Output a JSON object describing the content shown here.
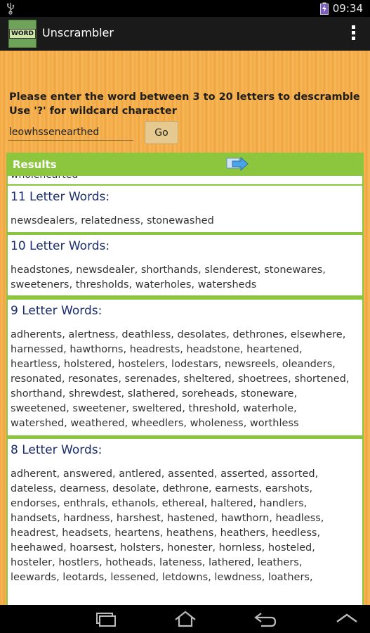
{
  "status_bar": {
    "time": "09:34"
  },
  "action_bar": {
    "icon_text": "WORD",
    "title": "Unscrambler"
  },
  "prompt": {
    "line1": "Please enter the word between 3 to 20 letters to descramble",
    "line2": "Use '?' for wildcard character"
  },
  "input": {
    "value": "leowhssenearthed"
  },
  "go_label": "Go",
  "results": {
    "label": "Results",
    "clipped_text": "wholehearted",
    "groups": [
      {
        "title": "11 Letter Words:",
        "lines": [
          "newsdealers, relatedness, stonewashed"
        ]
      },
      {
        "title": "10 Letter Words:",
        "lines": [
          "headstones, newsdealer, shorthands, slenderest, stonewares,",
          "sweeteners, thresholds, waterholes, watersheds"
        ]
      },
      {
        "title": "9 Letter Words:",
        "lines": [
          "adherents, alertness, deathless, desolates, dethrones, elsewhere,",
          "harnessed, hawthorns, headrests, headstone, heartened,",
          "heartless, holstered, hostelers, lodestars, newsreels, oleanders,",
          "resonated, resonates, serenades, sheltered, shoetrees, shortened,",
          "shorthand, shrewdest, slathered, soreheads, stoneware,",
          "sweetened, sweetener, sweltered, threshold, waterhole,",
          "watershed, weathered, wheedlers, wholeness, worthless"
        ]
      },
      {
        "title": "8 Letter Words:",
        "lines": [
          "adherent, answered, antlered, assented, asserted, assorted,",
          "dateless, dearness, desolate, dethrone, earnests, earshots,",
          "endorses, enthrals, ethanols, ethereal, haltered, handlers,",
          "handsets, hardness, harshest, hastened, hawthorn, headless,",
          "headrest, headsets, heartens, heathens, heathers, heedless,",
          "heehawed, hoarsest, holsters, honester, hornless, hosteled,",
          "hosteler, hostlers, hotheads, lateness, lathered, leathers,",
          "leewards, leotards, lessened, letdowns, lewdness, loathers,"
        ]
      }
    ]
  },
  "colors": {
    "results_green": "#8cc63f",
    "heading_navy": "#1a2d6e",
    "wood_orange": "#f3a844"
  }
}
